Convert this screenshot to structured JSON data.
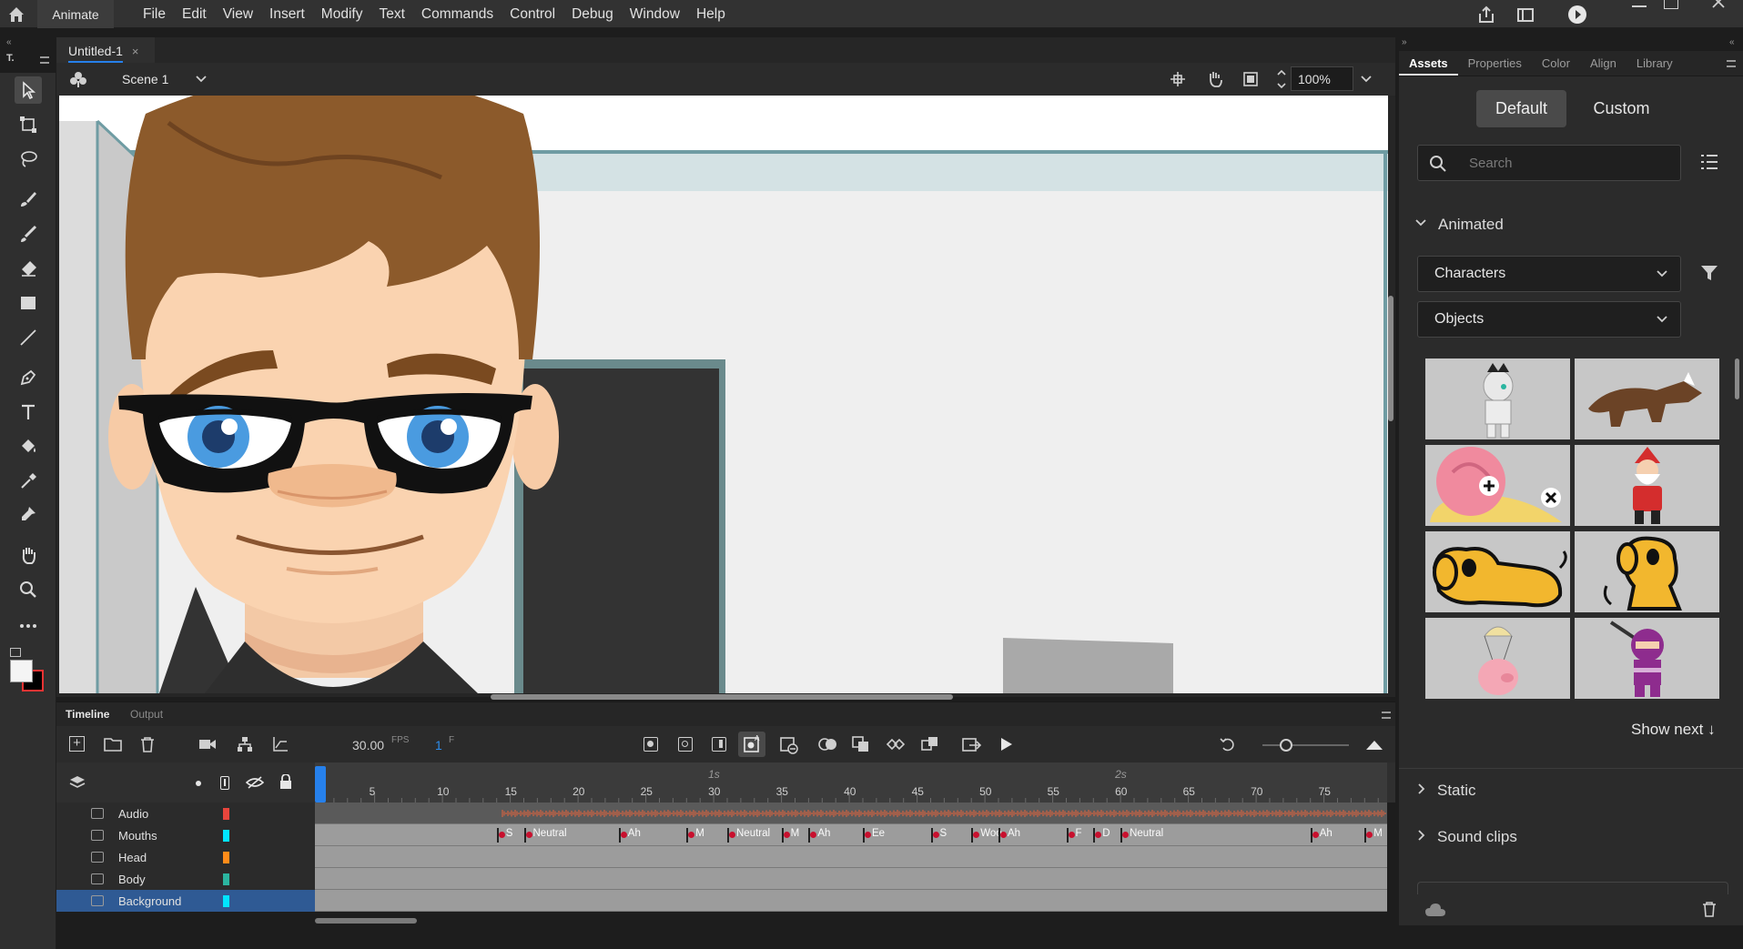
{
  "app": {
    "name": "Animate"
  },
  "menu": [
    "File",
    "Edit",
    "View",
    "Insert",
    "Modify",
    "Text",
    "Commands",
    "Control",
    "Debug",
    "Window",
    "Help"
  ],
  "tools_label": "T.",
  "document": {
    "tab": "Untitled-1",
    "close": "×",
    "scene": "Scene 1",
    "zoom": "100%"
  },
  "timeline": {
    "tabs": [
      "Timeline",
      "Output"
    ],
    "fps": "30.00",
    "fps_unit": "FPS",
    "frame": "1",
    "frame_unit": "F",
    "ruler": [
      "5",
      "10",
      "15",
      "20",
      "25",
      "30",
      "35",
      "40",
      "45",
      "50",
      "55",
      "60",
      "65",
      "70",
      "75"
    ],
    "seconds": [
      "1s",
      "2s"
    ],
    "layers": [
      {
        "name": "Audio",
        "color": "#e8453c"
      },
      {
        "name": "Mouths",
        "color": "#00e5ff"
      },
      {
        "name": "Head",
        "color": "#ff8c1a"
      },
      {
        "name": "Body",
        "color": "#2bb5a0"
      },
      {
        "name": "Background",
        "color": "#00e5ff"
      }
    ],
    "mouth_labels": [
      "S",
      "Neutral",
      "Ah",
      "M",
      "Neutral",
      "M",
      "Ah",
      "Ee",
      "S",
      "Woo",
      "Ah",
      "F",
      "D",
      "Neutral",
      "Ah",
      "M"
    ]
  },
  "panel": {
    "tabs": [
      "Assets",
      "Properties",
      "Color",
      "Align",
      "Library"
    ],
    "toggle": [
      "Default",
      "Custom"
    ],
    "search_placeholder": "Search",
    "animated": "Animated",
    "category": "Characters",
    "subcategory": "Objects",
    "show_next": "Show next ↓",
    "static": "Static",
    "sound_clips": "Sound clips"
  }
}
